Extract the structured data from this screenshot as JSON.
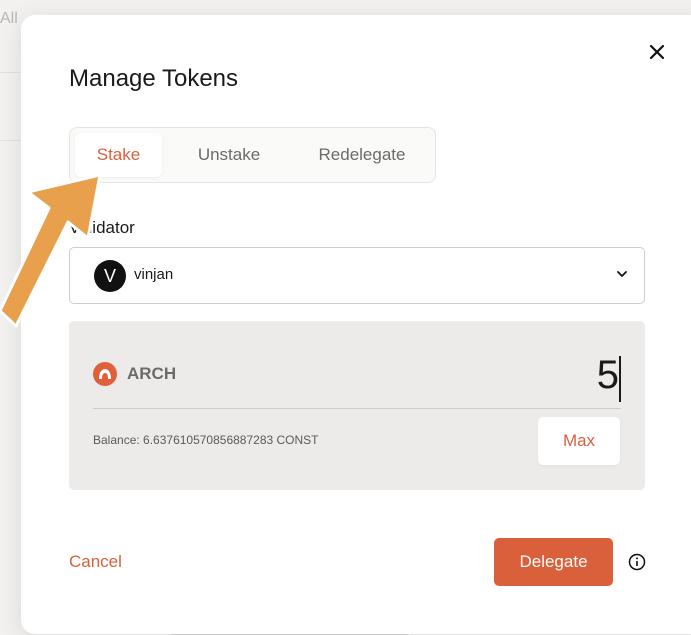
{
  "background": {
    "tab_text": "All"
  },
  "modal": {
    "title": "Manage Tokens",
    "tabs": [
      {
        "label": "Stake",
        "active": true
      },
      {
        "label": "Unstake",
        "active": false
      },
      {
        "label": "Redelegate",
        "active": false
      }
    ],
    "validator": {
      "label": "Validator",
      "label_visible_portion": "tor",
      "avatar_letter": "V",
      "selected": "vinjan",
      "icon": "chevron-down-icon"
    },
    "amount": {
      "token": "ARCH",
      "token_icon": "arch-token-icon",
      "value": "5",
      "balance": "Balance: 6.637610570856887283 CONST",
      "max_label": "Max"
    },
    "actions": {
      "cancel_label": "Cancel",
      "delegate_label": "Delegate",
      "info_icon": "info-icon"
    },
    "close_icon": "close-icon"
  },
  "colors": {
    "accent": "#d9603b",
    "annotation_arrow": "#e8a04c",
    "panel": "#edebea"
  }
}
